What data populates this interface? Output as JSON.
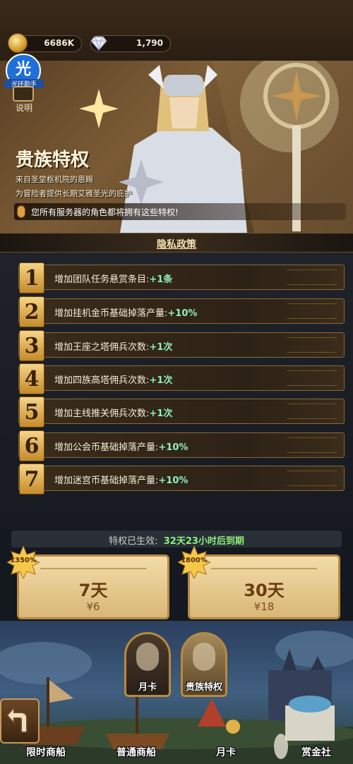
{
  "currency": {
    "gold": "6686K",
    "gems": "1,790"
  },
  "watermark": {
    "mark": "光",
    "caption": "光环助手"
  },
  "help": {
    "label": "说明"
  },
  "banner": {
    "title": "贵族特权",
    "desc_line1": "来自圣堂枢机院的恩赐",
    "desc_line2": "为冒险者提供长期艾雅圣光的庇护",
    "notice": "您所有服务器的角色都将拥有这些特权!"
  },
  "privacy_link": "隐私政策",
  "perks": [
    {
      "num": "1",
      "text": "增加团队任务悬赏条目:",
      "bonus": "+1条"
    },
    {
      "num": "2",
      "text": "增加挂机金币基础掉落产量:",
      "bonus": "+10%"
    },
    {
      "num": "3",
      "text": "增加王座之塔佣兵次数:",
      "bonus": "+1次"
    },
    {
      "num": "4",
      "text": "增加四族高塔佣兵次数:",
      "bonus": "+1次"
    },
    {
      "num": "5",
      "text": "增加主线推关佣兵次数:",
      "bonus": "+1次"
    },
    {
      "num": "6",
      "text": "增加公会币基础掉落产量:",
      "bonus": "+10%"
    },
    {
      "num": "7",
      "text": "增加迷宫币基础掉落产量:",
      "bonus": "+10%"
    }
  ],
  "status": {
    "label": "特权已生效:",
    "remaining": "32天23小时后到期"
  },
  "plans": [
    {
      "badge": "1350%",
      "days": "7天",
      "price": "¥6"
    },
    {
      "badge": "1800%",
      "days": "30天",
      "price": "¥18"
    }
  ],
  "portraits": {
    "month_card": "月卡",
    "noble": "贵族特权"
  },
  "nav": {
    "limited_ship": "限时商船",
    "normal_ship": "普通商船",
    "month_card": "月卡",
    "bounty": "赏金社"
  },
  "colors": {
    "accent_gold": "#d49a2a",
    "bonus_green": "#8ff0c0",
    "status_green": "#8ff07a"
  }
}
